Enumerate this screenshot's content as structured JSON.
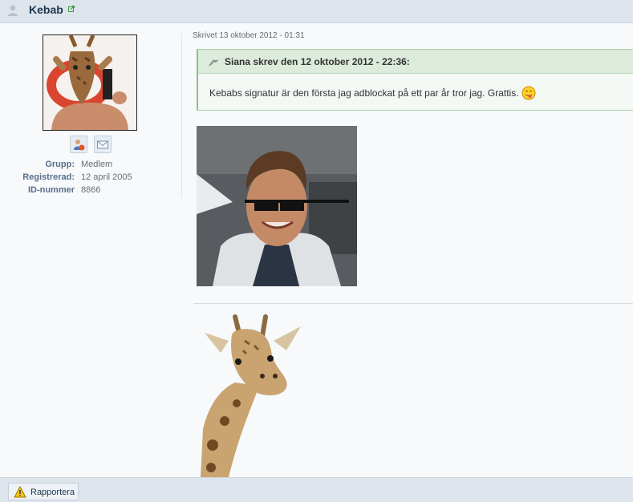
{
  "post": {
    "author": "Kebab",
    "date": "Skrivet 13 oktober 2012 - 01:31"
  },
  "author_info": {
    "rows": [
      {
        "label": "Grupp:",
        "value": "Medlem"
      },
      {
        "label": "Registrerad:",
        "value": "12 april 2005"
      },
      {
        "label": "ID-nummer",
        "value": "8866"
      }
    ]
  },
  "quote": {
    "header": "Siana skrev den 12 oktober 2012 - 22:36:",
    "text": "Kebabs signatur är den första jag adblockat på ett par år tror jag. Grattis."
  },
  "footer": {
    "report_label": "Rapportera"
  },
  "icons": {
    "user": "user-icon",
    "external_link": "external-link-icon",
    "profile": "profile-card-icon",
    "message": "envelope-icon",
    "quote": "quote-icon",
    "smiley": "tongue-smiley-icon",
    "report": "warning-icon"
  }
}
